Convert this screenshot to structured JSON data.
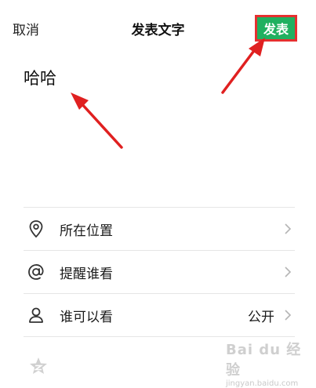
{
  "header": {
    "cancel_label": "取消",
    "title": "发表文字",
    "publish_label": "发表"
  },
  "compose": {
    "text": "哈哈"
  },
  "options": [
    {
      "icon": "location-pin-icon",
      "label": "所在位置",
      "value": ""
    },
    {
      "icon": "at-mention-icon",
      "label": "提醒谁看",
      "value": ""
    },
    {
      "icon": "person-icon",
      "label": "谁可以看",
      "value": "公开"
    }
  ],
  "footer": {
    "icon": "qzone-star-icon"
  },
  "watermark": {
    "brand": "Bai du 经验",
    "url": "jingyan.baidu.com"
  },
  "colors": {
    "publish_button": "#20b060",
    "highlight": "#e53030",
    "arrow": "#e02020",
    "divider": "#e6e6e6"
  }
}
